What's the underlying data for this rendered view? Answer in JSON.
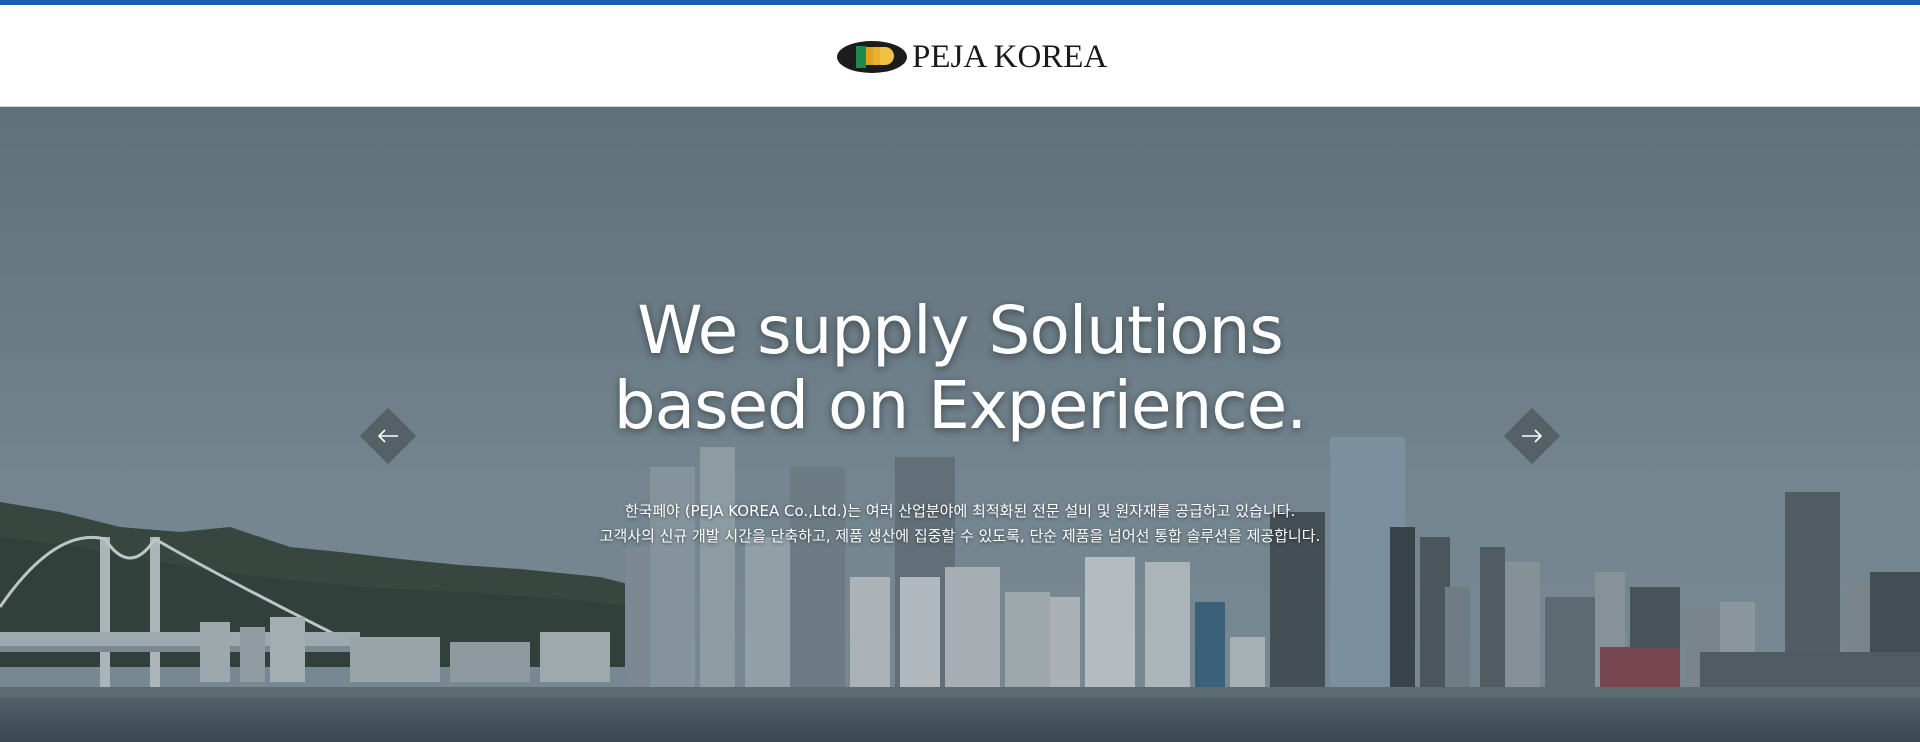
{
  "header": {
    "brand": "PEJA KOREA",
    "logo_icon": "peja-oval-logo-icon",
    "accent_color": "#1f5bb4"
  },
  "hero": {
    "title_line1": "We supply Solutions",
    "title_line2": "based on Experience.",
    "desc_line1": "한국페야 (PEJA KOREA Co.,Ltd.)는 여러 산업분야에 최적화된 전문 설비 및 원자재를 공급하고 있습니다.",
    "desc_line2": "고객사의 신규 개발 시간을 단축하고, 제품 생산에 집중할 수 있도록, 단순 제품을 넘어선 통합 솔루션을 제공합니다.",
    "prev_icon": "arrow-left-icon",
    "next_icon": "arrow-right-icon"
  }
}
